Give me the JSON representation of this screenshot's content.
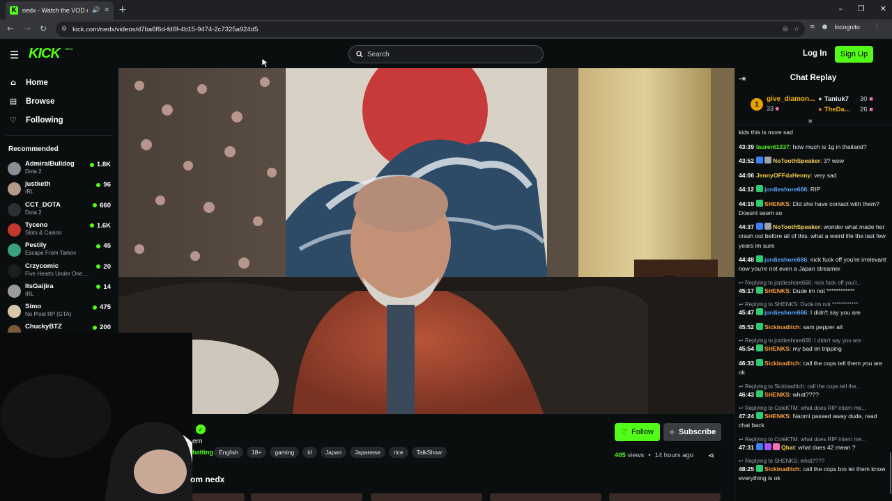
{
  "browser": {
    "tab_title": "nedx - Watch the VOD on Kick",
    "url": "kick.com/nedx/videos/d7ba6f6d-fd6f-4b15-9474-2c7325a924d5",
    "incognito_label": "Incognito",
    "favicon_letter": "K"
  },
  "header": {
    "logo": "KICK",
    "logo_badge": "BETA",
    "search_placeholder": "Search",
    "login_label": "Log In",
    "signup_label": "Sign Up"
  },
  "sidebar": {
    "nav": [
      {
        "label": "Home",
        "icon": "home-icon"
      },
      {
        "label": "Browse",
        "icon": "browse-icon"
      },
      {
        "label": "Following",
        "icon": "heart-icon"
      }
    ],
    "recommended_title": "Recommended",
    "recommended": [
      {
        "name": "AdmiralBulldog",
        "category": "Dota 2",
        "viewers": "1.8K",
        "color": "#8a8f96"
      },
      {
        "name": "justketh",
        "category": "IRL",
        "viewers": "96",
        "color": "#b59a8a"
      },
      {
        "name": "CCT_DOTA",
        "category": "Dota 2",
        "viewers": "660",
        "color": "#2d2f33"
      },
      {
        "name": "Tyceno",
        "category": "Slots & Casino",
        "viewers": "1.6K",
        "color": "#c0392b"
      },
      {
        "name": "Pestily",
        "category": "Escape From Tarkov",
        "viewers": "45",
        "color": "#3aa17e"
      },
      {
        "name": "Crzycomic",
        "category": "Five Hearts Under One ...",
        "viewers": "20",
        "color": "#1e1e1e"
      },
      {
        "name": "ItsGaijira",
        "category": "IRL",
        "viewers": "14",
        "color": "#9b9b9b"
      },
      {
        "name": "Simo",
        "category": "No Pixel RP (GTA)",
        "viewers": "475",
        "color": "#d6c7a8"
      },
      {
        "name": "ChuckyBTZ",
        "category": "",
        "viewers": "200",
        "color": "#7a5a3a"
      }
    ]
  },
  "video_info": {
    "title_fragment": "ern",
    "category_fragment": "hatting",
    "tags": [
      "English",
      "18+",
      "gaming",
      "irl",
      "Japan",
      "Japanese",
      "rice",
      "TalkShow"
    ],
    "follow_label": "Follow",
    "subscribe_label": "Subscribe",
    "views_count": "405",
    "views_label": "views",
    "separator": "•",
    "age": "14 hours ago",
    "more_from": "om nedx"
  },
  "chat": {
    "title": "Chat Replay",
    "leaderboard": {
      "first": {
        "rank": "1",
        "name": "give_diamon...",
        "count": "33"
      },
      "second": {
        "name": "Tanluk7",
        "count": "30"
      },
      "third": {
        "name": "TheDa...",
        "count": "26"
      }
    },
    "messages": [
      {
        "ts": "",
        "user": "",
        "user_color": "#fff",
        "text": "kids this is more sad",
        "badges": []
      },
      {
        "ts": "43:39",
        "user": "laurent1337",
        "user_color": "#53fc18",
        "text": ": how much is 1g in thailand?",
        "badges": []
      },
      {
        "ts": "43:52",
        "user": "NoToothSpeaker",
        "user_color": "#f4d35e",
        "text": ": 3? wow",
        "badges": [
          "#3b82f6",
          "#9ca3af"
        ]
      },
      {
        "ts": "44:06",
        "user": "JennyOFFdaHenny",
        "user_color": "#f2c94c",
        "text": ": very sad",
        "badges": []
      },
      {
        "ts": "44:12",
        "user": "jordieshore666",
        "user_color": "#5aa9ff",
        "text": ": RIP",
        "badges": [
          "#2ecc71"
        ]
      },
      {
        "ts": "44:19",
        "user": "SHENKS",
        "user_color": "#ff9f43",
        "text": ": Did she have contact with them? Doesnt seem so",
        "badges": [
          "#2ecc71"
        ]
      },
      {
        "ts": "44:37",
        "user": "NoToothSpeaker",
        "user_color": "#f4d35e",
        "text": ": wonder what made her crash out before all of this. what a weird life the last few years im sure",
        "badges": [
          "#3b82f6",
          "#9ca3af"
        ]
      },
      {
        "ts": "44:48",
        "user": "jordieshore666",
        "user_color": "#5aa9ff",
        "text": ": nick fuck off you're irrelevant now you're not even a Japan streamer",
        "badges": [
          "#2ecc71"
        ]
      },
      {
        "reply": "Replying to jordieshore666: nick fuck off you'r...",
        "ts": "45:17",
        "user": "SHENKS",
        "user_color": "#ff9f43",
        "text": ": Dude im not ************",
        "badges": [
          "#2ecc71"
        ]
      },
      {
        "reply": "Replying to SHENKS: Dude im not ************",
        "ts": "45:47",
        "user": "jordieshore666",
        "user_color": "#5aa9ff",
        "text": ": I didn't say you are",
        "badges": [
          "#2ecc71"
        ]
      },
      {
        "ts": "45:52",
        "user": "Sickinaditch",
        "user_color": "#ff9f43",
        "text": ": sam pepper alt",
        "badges": [
          "#2ecc71"
        ]
      },
      {
        "reply": "Replying to jordieshore666: I didn't say you are",
        "ts": "45:54",
        "user": "SHENKS",
        "user_color": "#ff9f43",
        "text": ": my bad im tripping",
        "badges": [
          "#2ecc71"
        ]
      },
      {
        "ts": "46:33",
        "user": "Sickinaditch",
        "user_color": "#ff9f43",
        "text": ": call the cops tell them you are ok",
        "badges": [
          "#2ecc71"
        ]
      },
      {
        "reply": "Replying to Sickinaditch: call the cops tell the...",
        "ts": "46:43",
        "user": "SHENKS",
        "user_color": "#ff9f43",
        "text": ": what????",
        "badges": [
          "#2ecc71"
        ]
      },
      {
        "reply": "Replying to ColeKTM: what does RIP intern me...",
        "ts": "47:24",
        "user": "SHENKS",
        "user_color": "#ff9f43",
        "text": ": Naomi passed away dude, read chat back",
        "badges": [
          "#2ecc71"
        ]
      },
      {
        "reply": "Replying to ColeKTM: what does RIP intern me...",
        "ts": "47:31",
        "user": "Qbat",
        "user_color": "#f4d35e",
        "text": ": what does 42 mean ?",
        "badges": [
          "#3b82f6",
          "#a855f7",
          "#f472b6"
        ]
      },
      {
        "reply": "Replying to SHENKS: what????",
        "ts": "48:25",
        "user": "Sickinaditch",
        "user_color": "#ff9f43",
        "text": ": call the cops bro let them know everything is ok",
        "badges": [
          "#2ecc71"
        ]
      }
    ]
  },
  "colors": {
    "brand": "#53fc18",
    "background": "#0b0e0f"
  }
}
